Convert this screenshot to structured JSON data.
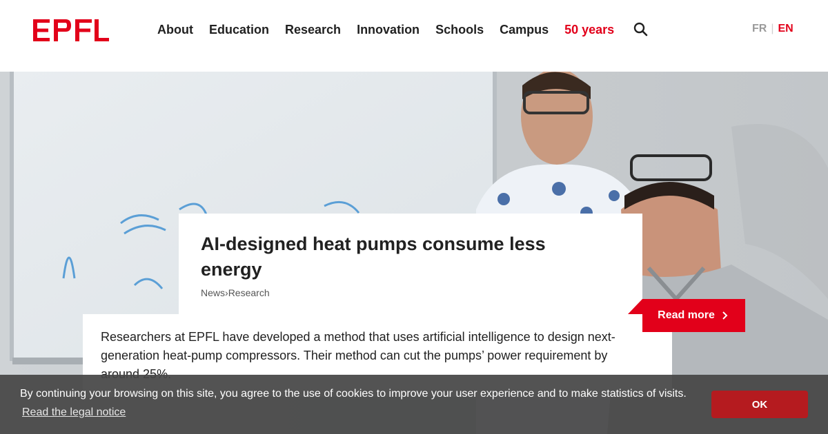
{
  "brand": {
    "logo_text": "EPFL",
    "accent_color": "#e2001a"
  },
  "nav": {
    "items": [
      {
        "label": "About"
      },
      {
        "label": "Education"
      },
      {
        "label": "Research"
      },
      {
        "label": "Innovation"
      },
      {
        "label": "Schools"
      },
      {
        "label": "Campus"
      },
      {
        "label": "50 years"
      }
    ],
    "search_icon": "search-icon"
  },
  "lang": {
    "fr": "FR",
    "en": "EN",
    "active": "EN"
  },
  "hero": {
    "title": "AI-designed heat pumps consume less energy",
    "breadcrumb": [
      "News",
      "Research"
    ],
    "breadcrumb_sep": "›",
    "read_more": "Read more",
    "lead": "Researchers at EPFL have developed a method that uses artificial intelligence to design next-generation heat-pump compressors. Their method can cut the pumps’ power requirement by around 25%."
  },
  "cookie": {
    "message": "By continuing your browsing on this site, you agree to the use of cookies to improve your user experience and to make statistics of visits.",
    "legal_link": "Read the legal notice",
    "ok_button": "OK"
  }
}
